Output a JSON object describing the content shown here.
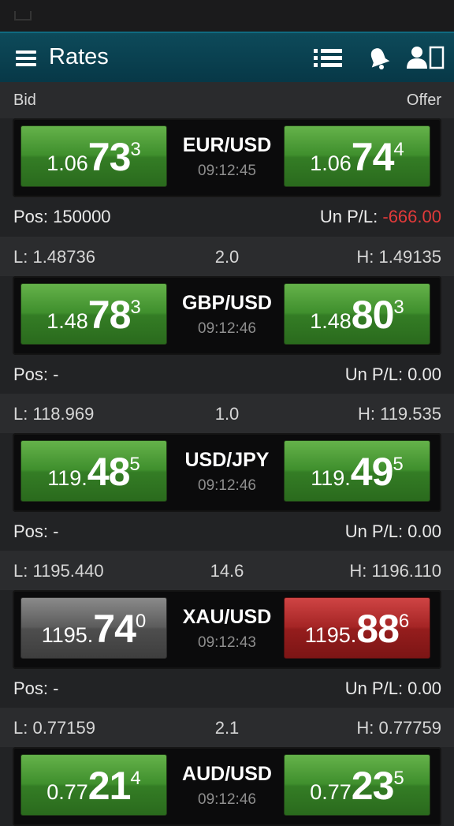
{
  "app": {
    "title": "Rates"
  },
  "header": {
    "bid_label": "Bid",
    "offer_label": "Offer"
  },
  "labels": {
    "pos_prefix": "Pos: ",
    "pl_prefix": "Un P/L: "
  },
  "icons": {
    "menu": "menu-icon",
    "list": "list-icon",
    "alerts": "bell-icon",
    "account": "account-icon"
  },
  "colors": {
    "buy_green": "#3f8f2d",
    "sell_red": "#a52525",
    "neutral_gray": "#5c5c5c",
    "loss_red": "#e23a3a",
    "appbar": "#0d4a5a"
  },
  "quotes": [
    {
      "pair": "EUR/USD",
      "time": "09:12:45",
      "low": "",
      "spread": "",
      "high": "",
      "bid": {
        "small": "1.06",
        "big": "73",
        "pip": "3",
        "color": "green"
      },
      "offer": {
        "small": "1.06",
        "big": "74",
        "pip": "4",
        "color": "green"
      },
      "pos": "Pos: 150000",
      "pl_label": "Un P/L: ",
      "pl_value": "-666.00",
      "pl_negative": true
    },
    {
      "pair": "GBP/USD",
      "time": "09:12:46",
      "low": "L: 1.48736",
      "spread": "2.0",
      "high": "H: 1.49135",
      "bid": {
        "small": "1.48",
        "big": "78",
        "pip": "3",
        "color": "green"
      },
      "offer": {
        "small": "1.48",
        "big": "80",
        "pip": "3",
        "color": "green"
      },
      "pos": "Pos: -",
      "pl_label": "Un P/L: ",
      "pl_value": "0.00",
      "pl_negative": false
    },
    {
      "pair": "USD/JPY",
      "time": "09:12:46",
      "low": "L: 118.969",
      "spread": "1.0",
      "high": "H: 119.535",
      "bid": {
        "small": "119.",
        "big": "48",
        "pip": "5",
        "color": "green"
      },
      "offer": {
        "small": "119.",
        "big": "49",
        "pip": "5",
        "color": "green"
      },
      "pos": "Pos: -",
      "pl_label": "Un P/L: ",
      "pl_value": "0.00",
      "pl_negative": false
    },
    {
      "pair": "XAU/USD",
      "time": "09:12:43",
      "low": "L: 1195.440",
      "spread": "14.6",
      "high": "H: 1196.110",
      "bid": {
        "small": "1195.",
        "big": "74",
        "pip": "0",
        "color": "gray"
      },
      "offer": {
        "small": "1195.",
        "big": "88",
        "pip": "6",
        "color": "red"
      },
      "pos": "Pos: -",
      "pl_label": "Un P/L: ",
      "pl_value": "0.00",
      "pl_negative": false
    },
    {
      "pair": "AUD/USD",
      "time": "09:12:46",
      "low": "L: 0.77159",
      "spread": "2.1",
      "high": "H: 0.77759",
      "bid": {
        "small": "0.77",
        "big": "21",
        "pip": "4",
        "color": "green"
      },
      "offer": {
        "small": "0.77",
        "big": "23",
        "pip": "5",
        "color": "green"
      },
      "pos": "",
      "pl_label": "",
      "pl_value": "",
      "pl_negative": false
    }
  ]
}
